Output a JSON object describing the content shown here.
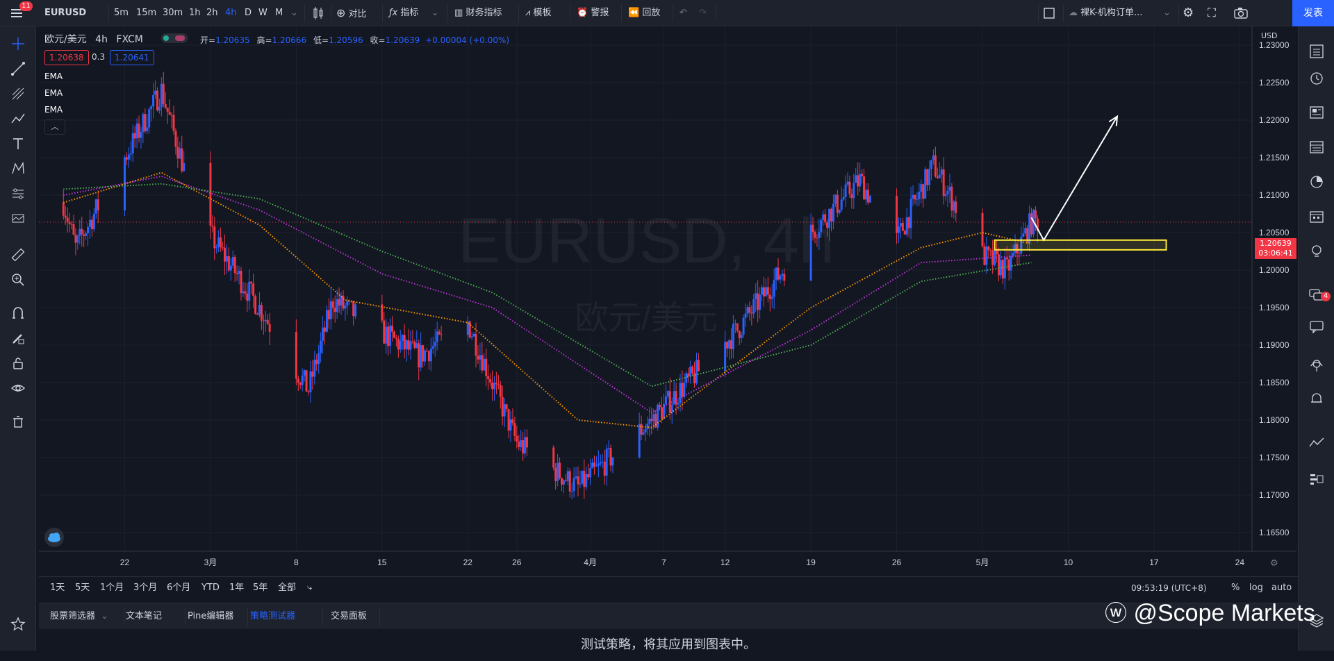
{
  "topbar": {
    "menu_badge": "11",
    "symbol": "EURUSD",
    "intervals": [
      {
        "label": "5m",
        "active": false
      },
      {
        "label": "15m",
        "active": false
      },
      {
        "label": "30m",
        "active": false
      },
      {
        "label": "1h",
        "active": false
      },
      {
        "label": "2h",
        "active": false
      },
      {
        "label": "4h",
        "active": true
      },
      {
        "label": "D",
        "active": false
      },
      {
        "label": "W",
        "active": false
      },
      {
        "label": "M",
        "active": false
      }
    ],
    "compare_label": "对比",
    "indicators_label": "指标",
    "financials_label": "财务指标",
    "templates_label": "模板",
    "alert_label": "警报",
    "replay_label": "回放",
    "layout_name": "裸K-机构订单...",
    "publish_label": "发表"
  },
  "chart": {
    "pair_name": "欧元/美元",
    "interval": "4h",
    "source": "FXCM",
    "ohlc": {
      "open_label": "开=",
      "open": "1.20635",
      "high_label": "高=",
      "high": "1.20666",
      "low_label": "低=",
      "low": "1.20596",
      "close_label": "收=",
      "close": "1.20639",
      "change": "+0.00004 (+0.00%)"
    },
    "sell_price": "1.20638",
    "spread": "0.3",
    "buy_price": "1.20641",
    "indicators": [
      "EMA",
      "EMA",
      "EMA"
    ],
    "watermark_symbol": "EURUSD, 4h",
    "watermark_name": "欧元/美元",
    "currency_label": "USD",
    "last_price": "1.20639",
    "countdown": "03:06:41",
    "colors": {
      "up": "#2962ff",
      "down": "#f23645",
      "ema_fast": "#ff9800",
      "ema_mid": "#ba35d6",
      "ema_slow": "#4caf50",
      "zone": "#ffeb3b"
    }
  },
  "chart_data": {
    "type": "candlestick",
    "title": "欧元/美元 4h FXCM",
    "ylim": [
      1.1625,
      1.2325
    ],
    "y_ticks": [
      "1.16500",
      "1.17000",
      "1.17500",
      "1.18000",
      "1.18500",
      "1.19000",
      "1.19500",
      "1.20000",
      "1.20500",
      "1.21000",
      "1.21500",
      "1.22000",
      "1.22500",
      "1.23000"
    ],
    "x_ticks": [
      "22",
      "3月",
      "8",
      "15",
      "22",
      "26",
      "4月",
      "7",
      "12",
      "19",
      "26",
      "5月",
      "10",
      "17",
      "24"
    ],
    "price_path": [
      {
        "date": "2021-02-17",
        "price": 1.209
      },
      {
        "date": "2021-02-18",
        "price": 1.203
      },
      {
        "date": "2021-02-22",
        "price": 1.215
      },
      {
        "date": "2021-02-25",
        "price": 1.224
      },
      {
        "date": "2021-02-28",
        "price": 1.207
      },
      {
        "date": "2021-03-05",
        "price": 1.195
      },
      {
        "date": "2021-03-09",
        "price": 1.184
      },
      {
        "date": "2021-03-11",
        "price": 1.196
      },
      {
        "date": "2021-03-18",
        "price": 1.1885
      },
      {
        "date": "2021-03-22",
        "price": 1.193
      },
      {
        "date": "2021-03-26",
        "price": 1.177
      },
      {
        "date": "2021-03-31",
        "price": 1.171
      },
      {
        "date": "2021-04-06",
        "price": 1.18
      },
      {
        "date": "2021-04-13",
        "price": 1.192
      },
      {
        "date": "2021-04-19",
        "price": 1.205
      },
      {
        "date": "2021-04-23",
        "price": 1.212
      },
      {
        "date": "2021-04-26",
        "price": 1.204
      },
      {
        "date": "2021-04-29",
        "price": 1.214
      },
      {
        "date": "2021-05-03",
        "price": 1.202
      },
      {
        "date": "2021-05-05",
        "price": 1.2
      },
      {
        "date": "2021-05-07",
        "price": 1.2064
      }
    ],
    "ema_series": [
      {
        "values": [
          {
            "date": "2021-02-17",
            "price": 1.209
          },
          {
            "date": "2021-02-25",
            "price": 1.213
          },
          {
            "date": "2021-03-05",
            "price": 1.206
          },
          {
            "date": "2021-03-12",
            "price": 1.196
          },
          {
            "date": "2021-03-22",
            "price": 1.193
          },
          {
            "date": "2021-03-31",
            "price": 1.18
          },
          {
            "date": "2021-04-06",
            "price": 1.179
          },
          {
            "date": "2021-04-19",
            "price": 1.195
          },
          {
            "date": "2021-04-28",
            "price": 1.203
          },
          {
            "date": "2021-05-03",
            "price": 1.205
          },
          {
            "date": "2021-05-07",
            "price": 1.2035
          }
        ]
      },
      {
        "values": [
          {
            "date": "2021-02-17",
            "price": 1.21
          },
          {
            "date": "2021-02-25",
            "price": 1.2125
          },
          {
            "date": "2021-03-05",
            "price": 1.208
          },
          {
            "date": "2021-03-15",
            "price": 1.1995
          },
          {
            "date": "2021-03-24",
            "price": 1.195
          },
          {
            "date": "2021-04-06",
            "price": 1.181
          },
          {
            "date": "2021-04-19",
            "price": 1.192
          },
          {
            "date": "2021-04-28",
            "price": 1.201
          },
          {
            "date": "2021-05-07",
            "price": 1.202
          }
        ]
      },
      {
        "values": [
          {
            "date": "2021-02-17",
            "price": 1.2108
          },
          {
            "date": "2021-02-25",
            "price": 1.2115
          },
          {
            "date": "2021-03-05",
            "price": 1.2095
          },
          {
            "date": "2021-03-15",
            "price": 1.2025
          },
          {
            "date": "2021-03-24",
            "price": 1.197
          },
          {
            "date": "2021-04-06",
            "price": 1.1845
          },
          {
            "date": "2021-04-19",
            "price": 1.19
          },
          {
            "date": "2021-04-28",
            "price": 1.1985
          },
          {
            "date": "2021-05-07",
            "price": 1.201
          }
        ]
      }
    ],
    "zone": {
      "date_from": "2021-05-04",
      "date_to": "2021-05-18",
      "price_from": 1.2027,
      "price_to": 1.204
    },
    "projection_arrow": [
      {
        "date": "2021-05-07",
        "price": 1.207
      },
      {
        "date": "2021-05-08",
        "price": 1.204
      },
      {
        "date": "2021-05-14",
        "price": 1.2205
      }
    ]
  },
  "range_bar": {
    "ranges": [
      "1天",
      "5天",
      "1个月",
      "3个月",
      "6个月",
      "YTD",
      "1年",
      "5年",
      "全部"
    ],
    "clock": "09:53:19 (UTC+8)",
    "percent_label": "%",
    "log_label": "log",
    "auto_label": "auto"
  },
  "bottom_tabs": [
    {
      "label": "股票筛选器",
      "active": false
    },
    {
      "label": "文本笔记",
      "active": false
    },
    {
      "label": "Pine编辑器",
      "active": false
    },
    {
      "label": "策略测试器",
      "active": true
    },
    {
      "label": "交易面板",
      "active": false
    }
  ],
  "panel_message": "测试策略，将其应用到图表中。",
  "watermark": "@Scope Markets",
  "right_badge": "4"
}
